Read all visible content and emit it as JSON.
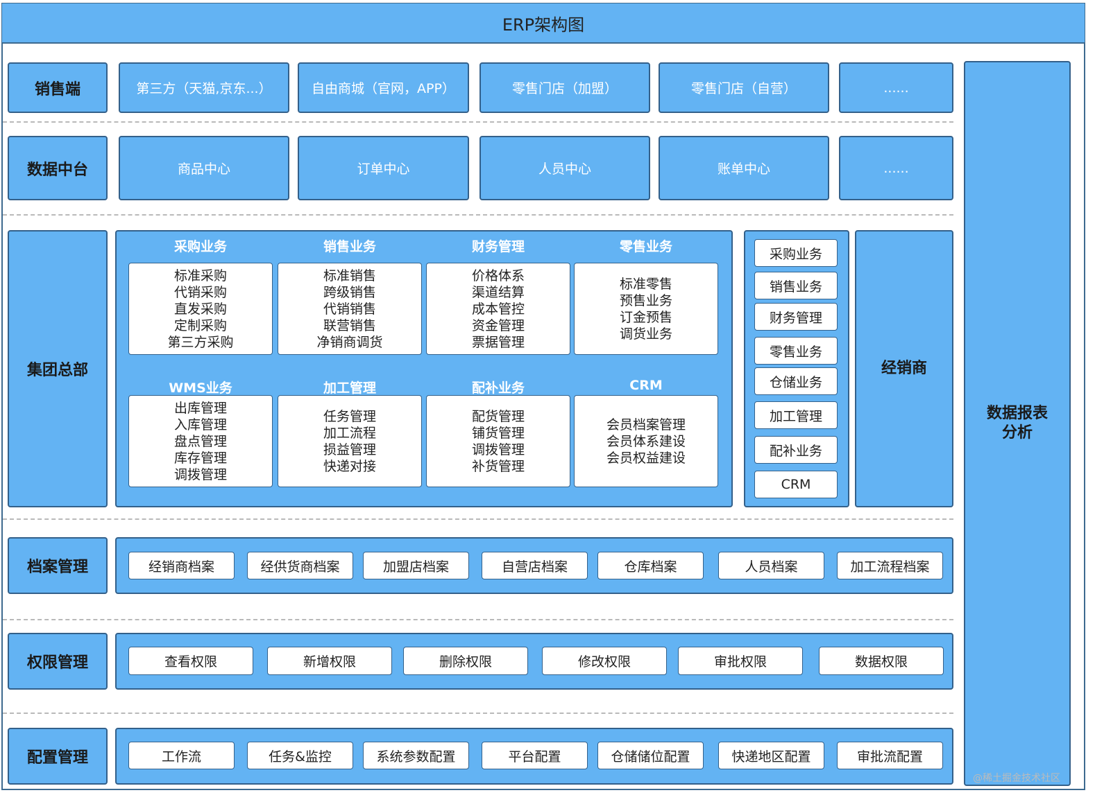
{
  "title": "ERP架构图",
  "rows": {
    "sales": {
      "label": "销售端",
      "cells": [
        "第三方（天猫,京东...）",
        "自由商城（官网，APP）",
        "零售门店（加盟）",
        "零售门店（自营）",
        "......"
      ]
    },
    "data_center": {
      "label": "数据中台",
      "cells": [
        "商品中心",
        "订单中心",
        "人员中心",
        "账单中心",
        "......"
      ]
    },
    "hq": {
      "label": "集团总部",
      "modules": [
        {
          "title": "采购业务",
          "items": [
            "标准采购",
            "代销采购",
            "直发采购",
            "定制采购",
            "第三方采购"
          ]
        },
        {
          "title": "销售业务",
          "items": [
            "标准销售",
            "跨级销售",
            "代销销售",
            "联营销售",
            "净销商调货"
          ]
        },
        {
          "title": "财务管理",
          "items": [
            "价格体系",
            "渠道结算",
            "成本管控",
            "资金管理",
            "票据管理"
          ]
        },
        {
          "title": "零售业务",
          "items": [
            "标准零售",
            "预售业务",
            "订金预售",
            "调货业务"
          ]
        },
        {
          "title": "WMS业务",
          "items": [
            "出库管理",
            "入库管理",
            "盘点管理",
            "库存管理",
            "调拨管理"
          ]
        },
        {
          "title": "加工管理",
          "items": [
            "任务管理",
            "加工流程",
            "损益管理",
            "快递对接"
          ]
        },
        {
          "title": "配补业务",
          "items": [
            "配货管理",
            "铺货管理",
            "调拨管理",
            "补货管理"
          ]
        },
        {
          "title": "CRM",
          "items": [
            "会员档案管理",
            "会员体系建设",
            "会员权益建设"
          ]
        }
      ],
      "side_list": [
        "采购业务",
        "销售业务",
        "财务管理",
        "零售业务",
        "仓储业务",
        "加工管理",
        "配补业务",
        "CRM"
      ],
      "dealer": "经销商"
    },
    "archive": {
      "label": "档案管理",
      "items": [
        "经销商档案",
        "经供货商档案",
        "加盟店档案",
        "自营店档案",
        "仓库档案",
        "人员档案",
        "加工流程档案"
      ]
    },
    "permission": {
      "label": "权限管理",
      "items": [
        "查看权限",
        "新增权限",
        "删除权限",
        "修改权限",
        "审批权限",
        "数据权限"
      ]
    },
    "config": {
      "label": "配置管理",
      "items": [
        "工作流",
        "任务&监控",
        "系统参数配置",
        "平台配置",
        "仓储储位配置",
        "快递地区配置",
        "审批流配置"
      ]
    }
  },
  "report": {
    "line1": "数据报表",
    "line2": "分析"
  },
  "watermark": "@稀土掘金技术社区"
}
